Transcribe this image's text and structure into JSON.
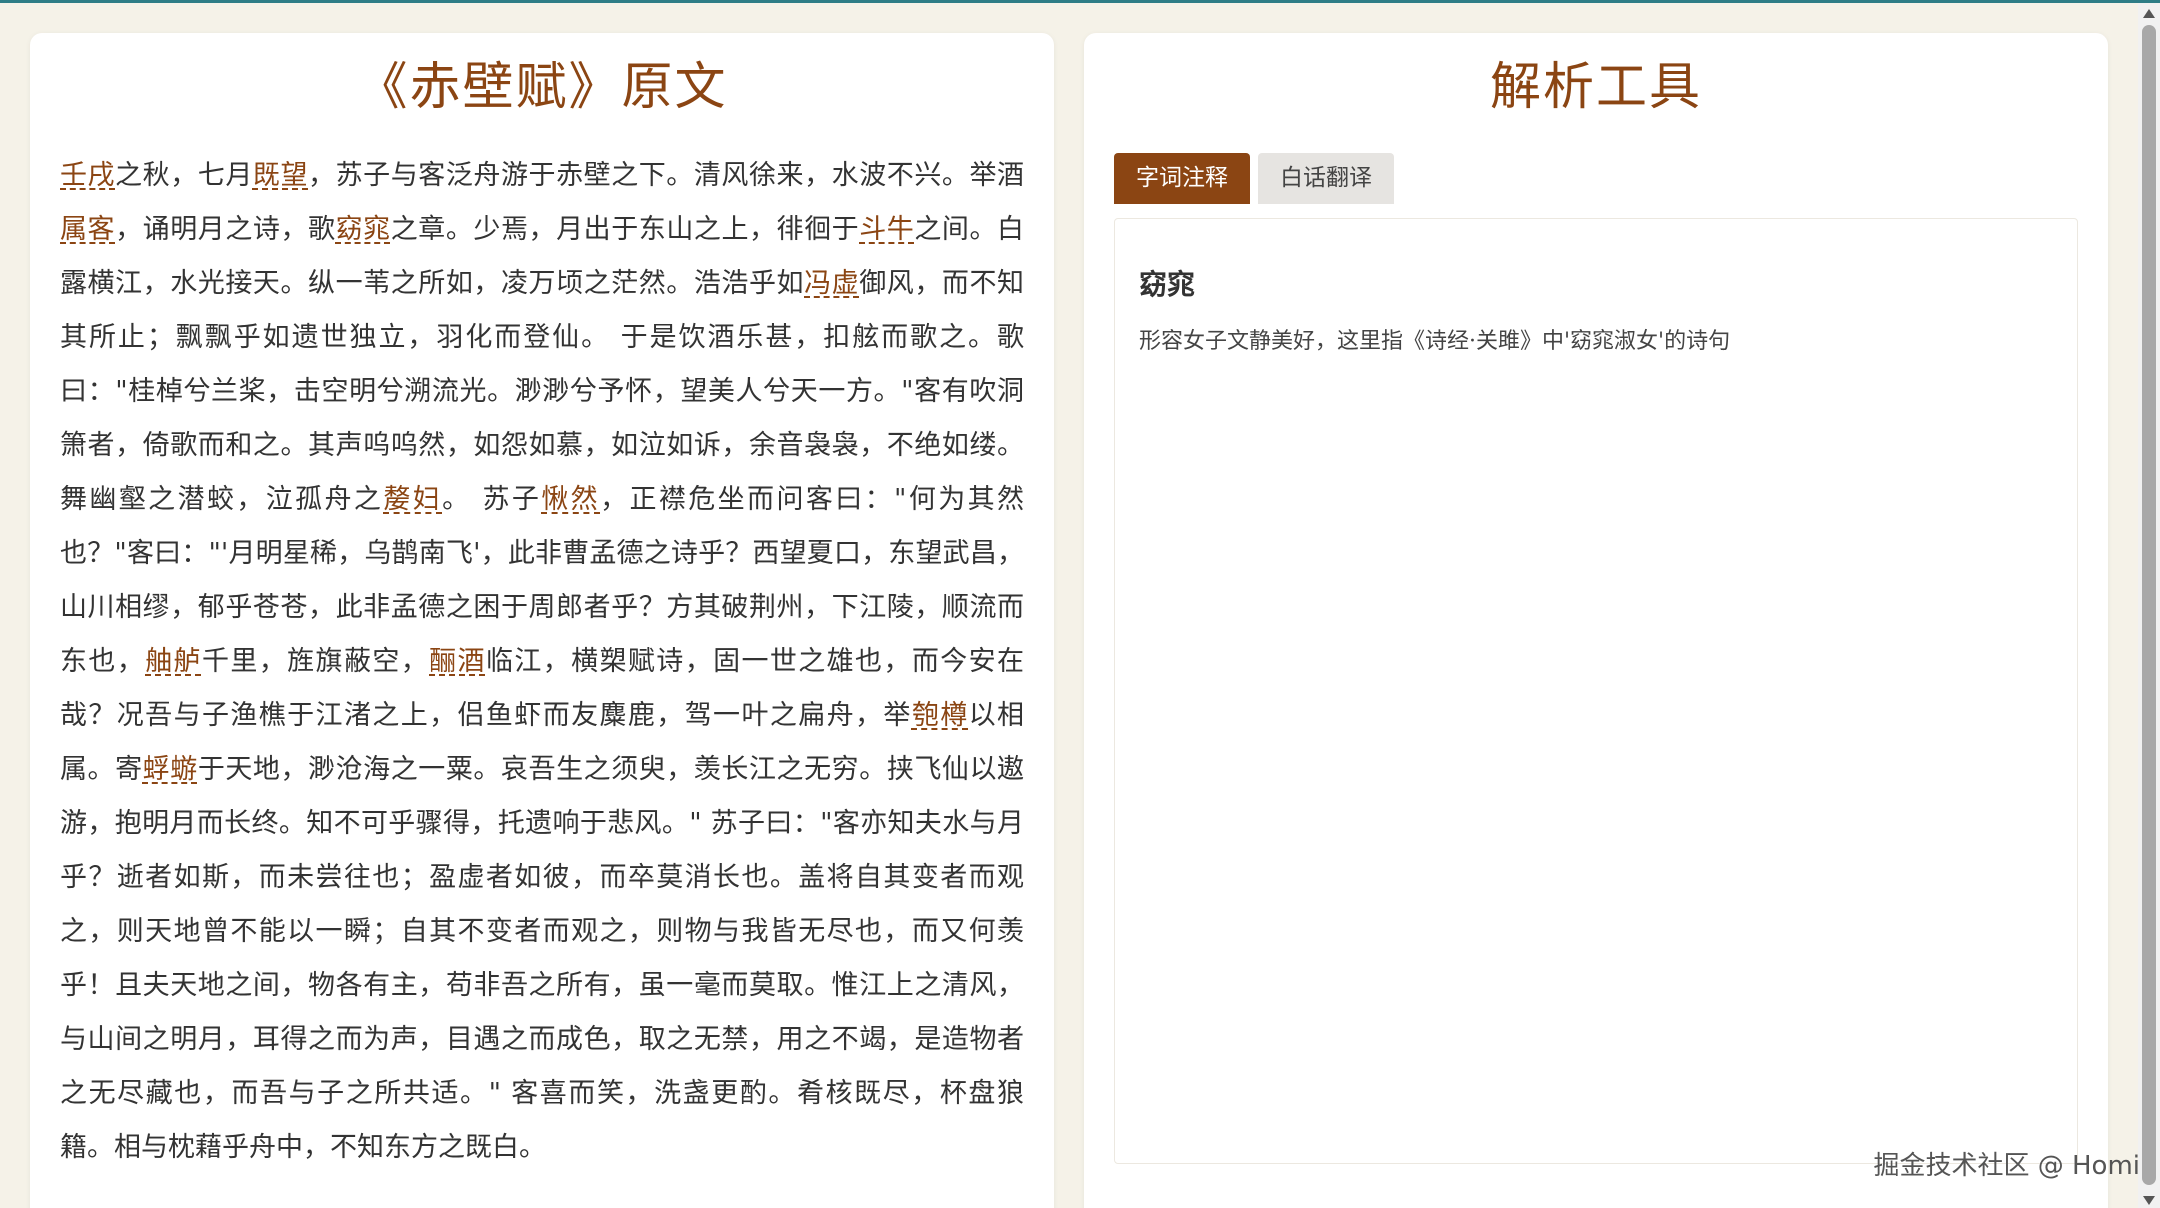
{
  "left_panel": {
    "title": "《赤壁赋》原文",
    "segments": [
      {
        "t": "壬戌",
        "term": true
      },
      {
        "t": "之秋，七月"
      },
      {
        "t": "既望",
        "term": true
      },
      {
        "t": "，苏子与客泛舟游于赤壁之下。清风徐来，水波不兴。举酒"
      },
      {
        "t": "属客",
        "term": true
      },
      {
        "t": "，诵明月之诗，歌"
      },
      {
        "t": "窈窕",
        "term": true
      },
      {
        "t": "之章。少焉，月出于东山之上，徘徊于"
      },
      {
        "t": "斗牛",
        "term": true
      },
      {
        "t": "之间。白露横江，水光接天。纵一苇之所如，凌万顷之茫然。浩浩乎如"
      },
      {
        "t": "冯虚",
        "term": true
      },
      {
        "t": "御风，而不知其所止；飘飘乎如遗世独立，羽化而登仙。 于是饮酒乐甚，扣舷而歌之。歌曰：\"桂棹兮兰桨，击空明兮溯流光。渺渺兮予怀，望美人兮天一方。\"客有吹洞箫者，倚歌而和之。其声呜呜然，如怨如慕，如泣如诉，余音袅袅，不绝如缕。舞幽壑之潜蛟，泣孤舟之"
      },
      {
        "t": "嫠妇",
        "term": true
      },
      {
        "t": "。 苏子"
      },
      {
        "t": "愀然",
        "term": true
      },
      {
        "t": "，正襟危坐而问客曰：\"何为其然也？\"客曰：\"'月明星稀，乌鹊南飞'，此非曹孟德之诗乎？西望夏口，东望武昌，山川相缪，郁乎苍苍，此非孟德之困于周郎者乎？方其破荆州，下江陵，顺流而东也，"
      },
      {
        "t": "舳舻",
        "term": true
      },
      {
        "t": "千里，旌旗蔽空，"
      },
      {
        "t": "酾酒",
        "term": true
      },
      {
        "t": "临江，横槊赋诗，固一世之雄也，而今安在哉？况吾与子渔樵于江渚之上，侣鱼虾而友麋鹿，驾一叶之扁舟，举"
      },
      {
        "t": "匏樽",
        "term": true
      },
      {
        "t": "以相属。寄"
      },
      {
        "t": "蜉蝣",
        "term": true
      },
      {
        "t": "于天地，渺沧海之一粟。哀吾生之须臾，羡长江之无穷。挟飞仙以遨游，抱明月而长终。知不可乎骤得，托遗响于悲风。\" 苏子曰：\"客亦知夫水与月乎？逝者如斯，而未尝往也；盈虚者如彼，而卒莫消长也。盖将自其变者而观之，则天地曾不能以一瞬；自其不变者而观之，则物与我皆无尽也，而又何羡乎！且夫天地之间，物各有主，苟非吾之所有，虽一毫而莫取。惟江上之清风，与山间之明月，耳得之而为声，目遇之而成色，取之无禁，用之不竭，是造物者之无尽藏也，而吾与子之所共适。\" 客喜而笑，洗盏更酌。肴核既尽，杯盘狼籍。相与枕藉乎舟中，不知东方之既白。"
      }
    ]
  },
  "right_panel": {
    "title": "解析工具",
    "tabs": [
      {
        "label": "字词注释",
        "active": true
      },
      {
        "label": "白话翻译",
        "active": false
      }
    ],
    "note": {
      "term": "窈窕",
      "definition": "形容女子文静美好，这里指《诗经·关雎》中'窈窕淑女'的诗句"
    }
  },
  "watermark": "掘金技术社区 @ Homi",
  "colors": {
    "accent": "#8b4513",
    "background": "#f5f2e8",
    "panel": "#ffffff",
    "text": "#333333"
  }
}
